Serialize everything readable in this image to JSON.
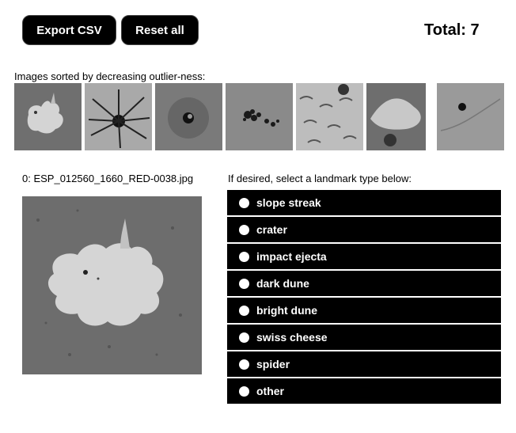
{
  "toolbar": {
    "export_label": "Export CSV",
    "reset_label": "Reset all",
    "total_text": "Total: 7"
  },
  "strip": {
    "label": "Images sorted by decreasing outlier-ness:",
    "thumbs": [
      "bright-ejecta",
      "dark-spider",
      "crater",
      "dark-dots",
      "dunes",
      "bright-dune",
      "small-crater"
    ]
  },
  "main": {
    "caption": "0: ESP_012560_1660_RED-0038.jpg"
  },
  "landmarks": {
    "prompt": "If desired, select a landmark type below:",
    "options": [
      "slope streak",
      "crater",
      "impact ejecta",
      "dark dune",
      "bright dune",
      "swiss cheese",
      "spider",
      "other"
    ]
  }
}
